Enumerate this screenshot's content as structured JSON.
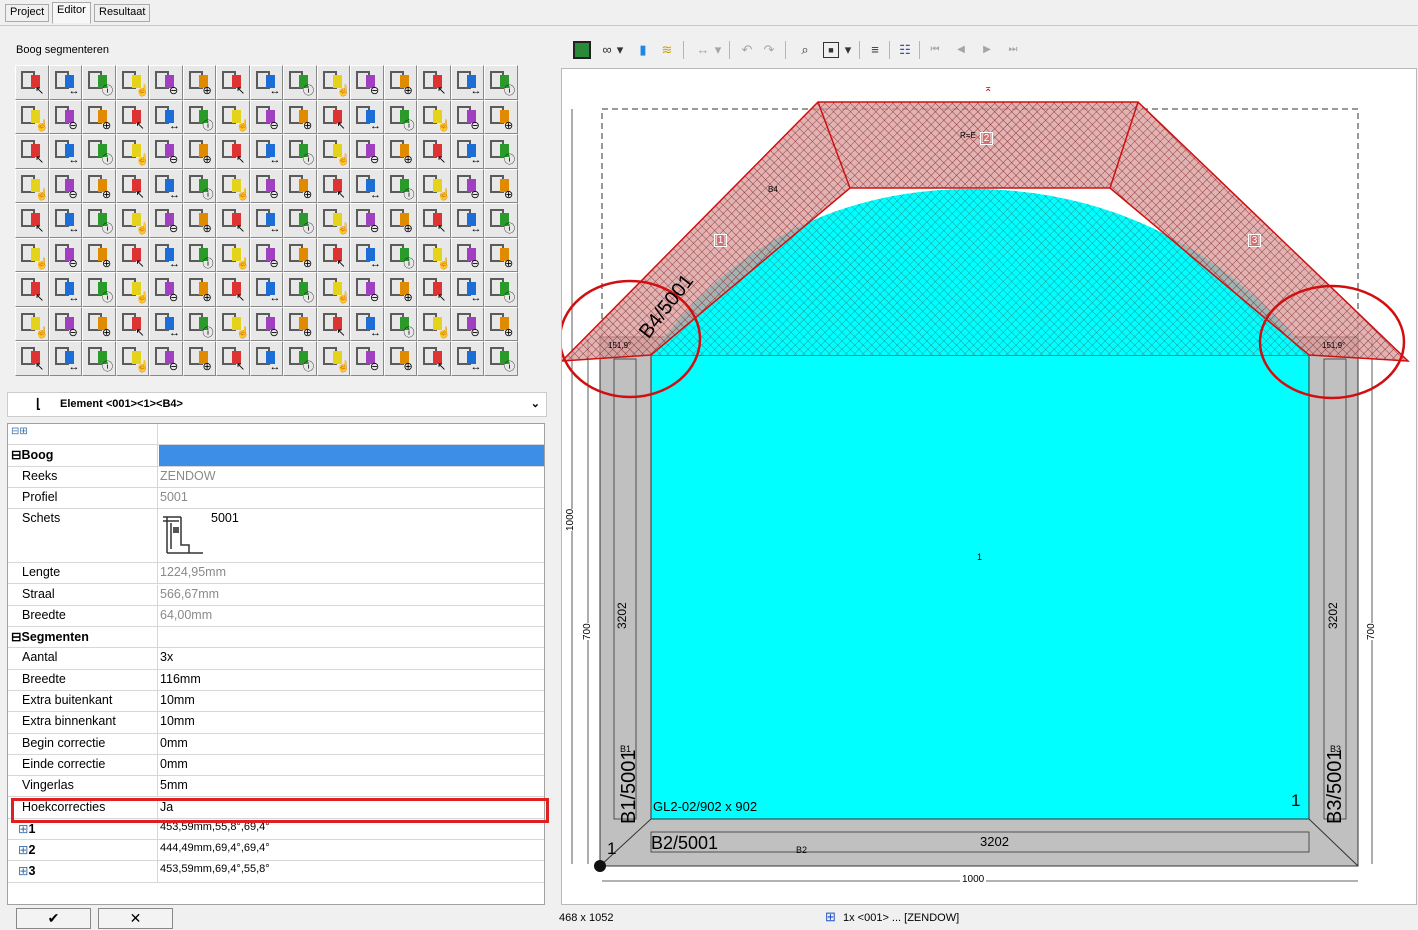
{
  "tabs": [
    {
      "label": "Project"
    },
    {
      "label": "Editor"
    },
    {
      "label": "Resultaat"
    }
  ],
  "left": {
    "group_title": "Boog segmenteren",
    "element_selector": "Element <001><1><B4>",
    "props": [
      {
        "k": "",
        "v": ""
      },
      {
        "k": "Boog",
        "v": ""
      },
      {
        "k": "Reeks",
        "v": "ZENDOW"
      },
      {
        "k": "Profiel",
        "v": "5001"
      },
      {
        "k": "Schets",
        "v": "5001"
      },
      {
        "k": "Lengte",
        "v": "1224,95mm"
      },
      {
        "k": "Straal",
        "v": "566,67mm"
      },
      {
        "k": "Breedte",
        "v": "64,00mm"
      },
      {
        "k": "Segmenten",
        "v": ""
      },
      {
        "k": "Aantal",
        "v": "3x"
      },
      {
        "k": "Breedte",
        "v": "116mm"
      },
      {
        "k": "Extra buitenkant",
        "v": "10mm"
      },
      {
        "k": "Extra binnenkant",
        "v": "10mm"
      },
      {
        "k": "Begin correctie",
        "v": "0mm"
      },
      {
        "k": "Einde correctie",
        "v": "0mm"
      },
      {
        "k": "Vingerlas",
        "v": "5mm"
      },
      {
        "k": "Hoekcorrecties",
        "v": "Ja"
      },
      {
        "k": "1",
        "v": "453,59mm,55,8°,69,4°"
      },
      {
        "k": "2",
        "v": "444,49mm,69,4°,69,4°"
      },
      {
        "k": "3",
        "v": "453,59mm,69,4°,55,8°"
      }
    ],
    "ok": "✔",
    "cancel": "✕"
  },
  "drawing": {
    "bottom_dim": "1000",
    "left_dim_top": "1000",
    "left_dim_bottom": "700",
    "right_dim": "700",
    "arc_profile": "B4/5001",
    "left_profile": "B1/5001",
    "right_profile": "B3/5001",
    "bottom_profile": "B2/5001",
    "len_left": "3202",
    "len_right": "3202",
    "len_bottom": "3202",
    "glass_label": "GL2-02/902 x 902",
    "glass_no": "1",
    "corner_no": "1",
    "seg1": "[1]",
    "seg2": "[2]",
    "seg3": "[3]",
    "b1": "B1",
    "b2": "B2",
    "b3": "B3",
    "b4": "B4",
    "r": "R=E",
    "center": "1",
    "angle_l": "151,9°",
    "angle_r": "151,9°"
  },
  "status": {
    "size": "468 x 1052",
    "info": "1x <001> ... [ZENDOW]"
  },
  "colors": {
    "glass": "#00ffff",
    "frame": "#c0c0c0",
    "arc_fill": "#d99a9a",
    "highlight": "#e02020"
  }
}
